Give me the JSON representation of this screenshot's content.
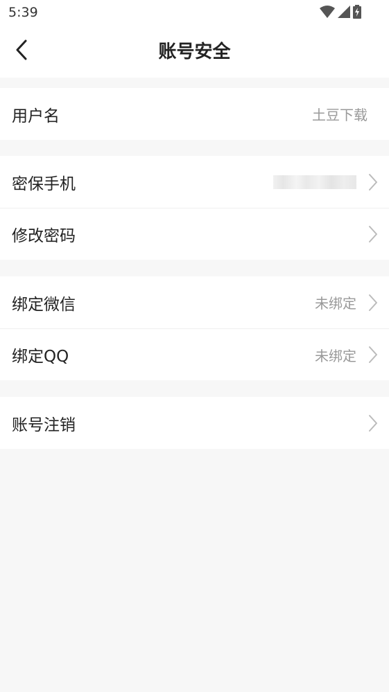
{
  "status_bar": {
    "time": "5:39",
    "icons": [
      "wifi-icon",
      "signal-icon",
      "battery-charging-icon"
    ]
  },
  "header": {
    "back_icon": "chevron-left-icon",
    "title": "账号安全"
  },
  "groups": [
    {
      "rows": [
        {
          "label": "用户名",
          "value": "土豆下载",
          "has_chevron": false
        }
      ]
    },
    {
      "rows": [
        {
          "label": "密保手机",
          "value": "",
          "value_blurred": true,
          "has_chevron": true
        },
        {
          "label": "修改密码",
          "value": "",
          "has_chevron": true
        }
      ]
    },
    {
      "rows": [
        {
          "label": "绑定微信",
          "value": "未绑定",
          "has_chevron": true
        },
        {
          "label": "绑定QQ",
          "value": "未绑定",
          "has_chevron": true
        }
      ]
    },
    {
      "rows": [
        {
          "label": "账号注销",
          "value": "",
          "has_chevron": true
        }
      ]
    }
  ],
  "colors": {
    "background": "#f7f7f7",
    "row_background": "#ffffff",
    "label_text": "#222222",
    "value_text": "#999999",
    "chevron": "#bbbbbb"
  }
}
